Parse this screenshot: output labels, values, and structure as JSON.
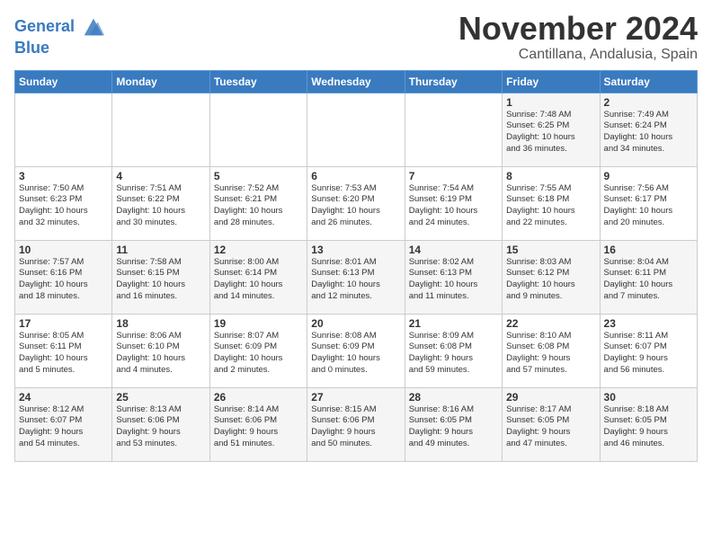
{
  "logo": {
    "line1": "General",
    "line2": "Blue"
  },
  "title": "November 2024",
  "subtitle": "Cantillana, Andalusia, Spain",
  "days_header": [
    "Sunday",
    "Monday",
    "Tuesday",
    "Wednesday",
    "Thursday",
    "Friday",
    "Saturday"
  ],
  "weeks": [
    [
      {
        "day": "",
        "content": ""
      },
      {
        "day": "",
        "content": ""
      },
      {
        "day": "",
        "content": ""
      },
      {
        "day": "",
        "content": ""
      },
      {
        "day": "",
        "content": ""
      },
      {
        "day": "1",
        "content": "Sunrise: 7:48 AM\nSunset: 6:25 PM\nDaylight: 10 hours\nand 36 minutes."
      },
      {
        "day": "2",
        "content": "Sunrise: 7:49 AM\nSunset: 6:24 PM\nDaylight: 10 hours\nand 34 minutes."
      }
    ],
    [
      {
        "day": "3",
        "content": "Sunrise: 7:50 AM\nSunset: 6:23 PM\nDaylight: 10 hours\nand 32 minutes."
      },
      {
        "day": "4",
        "content": "Sunrise: 7:51 AM\nSunset: 6:22 PM\nDaylight: 10 hours\nand 30 minutes."
      },
      {
        "day": "5",
        "content": "Sunrise: 7:52 AM\nSunset: 6:21 PM\nDaylight: 10 hours\nand 28 minutes."
      },
      {
        "day": "6",
        "content": "Sunrise: 7:53 AM\nSunset: 6:20 PM\nDaylight: 10 hours\nand 26 minutes."
      },
      {
        "day": "7",
        "content": "Sunrise: 7:54 AM\nSunset: 6:19 PM\nDaylight: 10 hours\nand 24 minutes."
      },
      {
        "day": "8",
        "content": "Sunrise: 7:55 AM\nSunset: 6:18 PM\nDaylight: 10 hours\nand 22 minutes."
      },
      {
        "day": "9",
        "content": "Sunrise: 7:56 AM\nSunset: 6:17 PM\nDaylight: 10 hours\nand 20 minutes."
      }
    ],
    [
      {
        "day": "10",
        "content": "Sunrise: 7:57 AM\nSunset: 6:16 PM\nDaylight: 10 hours\nand 18 minutes."
      },
      {
        "day": "11",
        "content": "Sunrise: 7:58 AM\nSunset: 6:15 PM\nDaylight: 10 hours\nand 16 minutes."
      },
      {
        "day": "12",
        "content": "Sunrise: 8:00 AM\nSunset: 6:14 PM\nDaylight: 10 hours\nand 14 minutes."
      },
      {
        "day": "13",
        "content": "Sunrise: 8:01 AM\nSunset: 6:13 PM\nDaylight: 10 hours\nand 12 minutes."
      },
      {
        "day": "14",
        "content": "Sunrise: 8:02 AM\nSunset: 6:13 PM\nDaylight: 10 hours\nand 11 minutes."
      },
      {
        "day": "15",
        "content": "Sunrise: 8:03 AM\nSunset: 6:12 PM\nDaylight: 10 hours\nand 9 minutes."
      },
      {
        "day": "16",
        "content": "Sunrise: 8:04 AM\nSunset: 6:11 PM\nDaylight: 10 hours\nand 7 minutes."
      }
    ],
    [
      {
        "day": "17",
        "content": "Sunrise: 8:05 AM\nSunset: 6:11 PM\nDaylight: 10 hours\nand 5 minutes."
      },
      {
        "day": "18",
        "content": "Sunrise: 8:06 AM\nSunset: 6:10 PM\nDaylight: 10 hours\nand 4 minutes."
      },
      {
        "day": "19",
        "content": "Sunrise: 8:07 AM\nSunset: 6:09 PM\nDaylight: 10 hours\nand 2 minutes."
      },
      {
        "day": "20",
        "content": "Sunrise: 8:08 AM\nSunset: 6:09 PM\nDaylight: 10 hours\nand 0 minutes."
      },
      {
        "day": "21",
        "content": "Sunrise: 8:09 AM\nSunset: 6:08 PM\nDaylight: 9 hours\nand 59 minutes."
      },
      {
        "day": "22",
        "content": "Sunrise: 8:10 AM\nSunset: 6:08 PM\nDaylight: 9 hours\nand 57 minutes."
      },
      {
        "day": "23",
        "content": "Sunrise: 8:11 AM\nSunset: 6:07 PM\nDaylight: 9 hours\nand 56 minutes."
      }
    ],
    [
      {
        "day": "24",
        "content": "Sunrise: 8:12 AM\nSunset: 6:07 PM\nDaylight: 9 hours\nand 54 minutes."
      },
      {
        "day": "25",
        "content": "Sunrise: 8:13 AM\nSunset: 6:06 PM\nDaylight: 9 hours\nand 53 minutes."
      },
      {
        "day": "26",
        "content": "Sunrise: 8:14 AM\nSunset: 6:06 PM\nDaylight: 9 hours\nand 51 minutes."
      },
      {
        "day": "27",
        "content": "Sunrise: 8:15 AM\nSunset: 6:06 PM\nDaylight: 9 hours\nand 50 minutes."
      },
      {
        "day": "28",
        "content": "Sunrise: 8:16 AM\nSunset: 6:05 PM\nDaylight: 9 hours\nand 49 minutes."
      },
      {
        "day": "29",
        "content": "Sunrise: 8:17 AM\nSunset: 6:05 PM\nDaylight: 9 hours\nand 47 minutes."
      },
      {
        "day": "30",
        "content": "Sunrise: 8:18 AM\nSunset: 6:05 PM\nDaylight: 9 hours\nand 46 minutes."
      }
    ]
  ]
}
